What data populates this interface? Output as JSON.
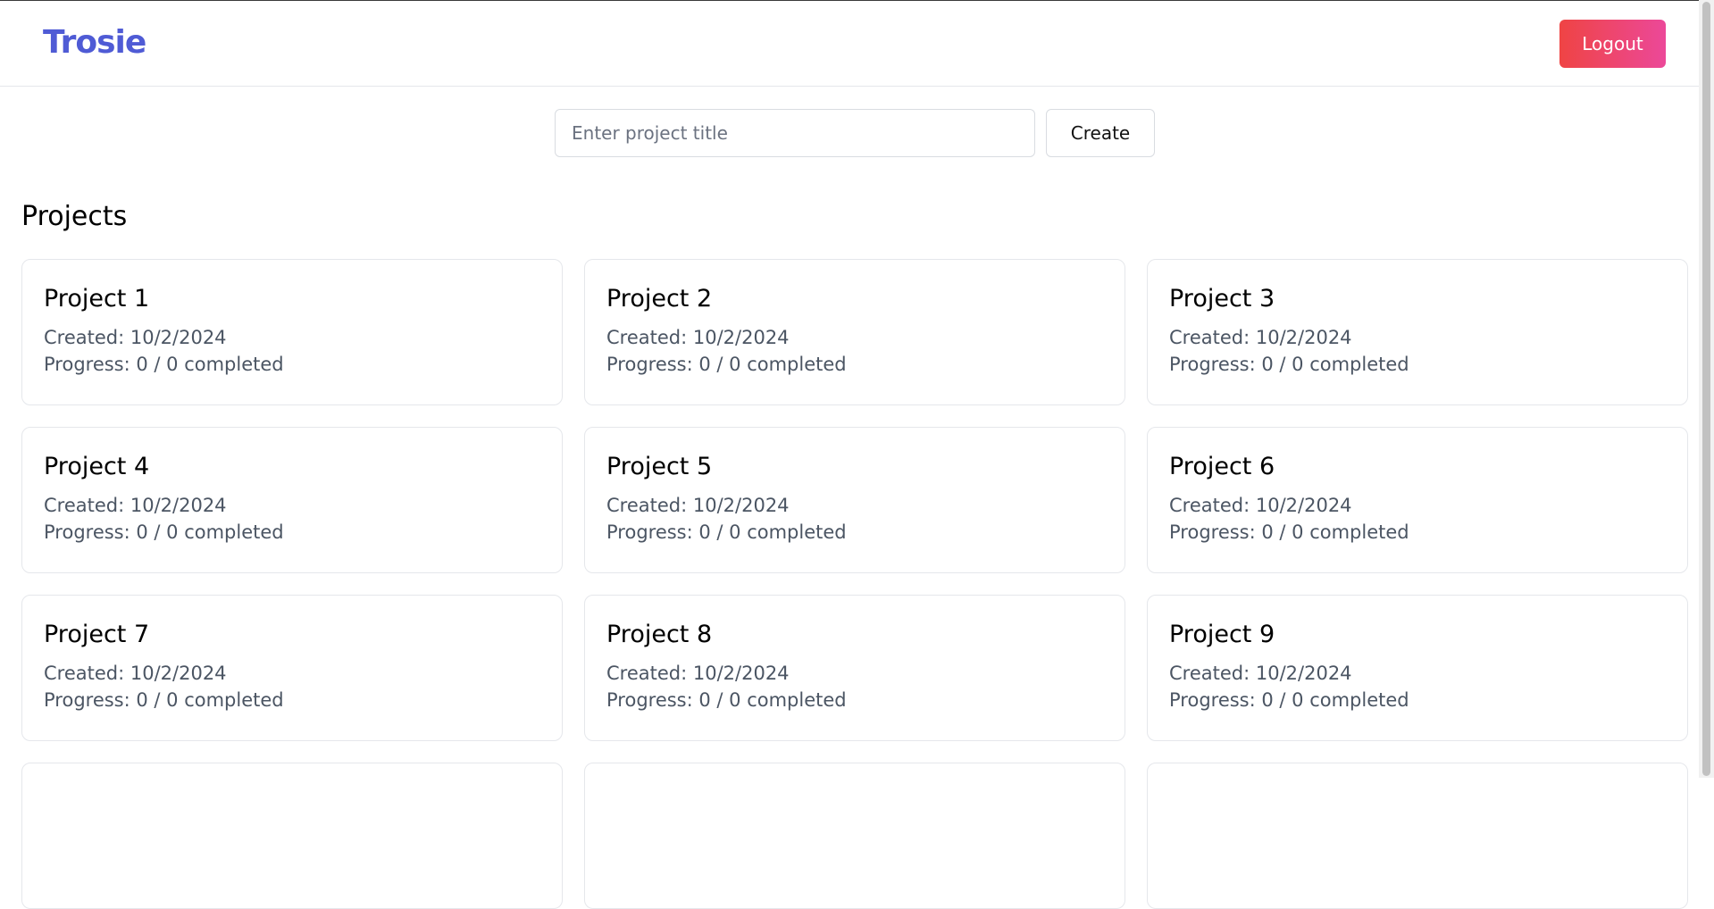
{
  "header": {
    "logo": "Trosie",
    "logout_label": "Logout"
  },
  "create": {
    "placeholder": "Enter project title",
    "value": "",
    "button_label": "Create"
  },
  "projects_section": {
    "title": "Projects",
    "items": [
      {
        "title": "Project 1",
        "created": "Created: 10/2/2024",
        "progress": "Progress: 0 / 0 completed"
      },
      {
        "title": "Project 2",
        "created": "Created: 10/2/2024",
        "progress": "Progress: 0 / 0 completed"
      },
      {
        "title": "Project 3",
        "created": "Created: 10/2/2024",
        "progress": "Progress: 0 / 0 completed"
      },
      {
        "title": "Project 4",
        "created": "Created: 10/2/2024",
        "progress": "Progress: 0 / 0 completed"
      },
      {
        "title": "Project 5",
        "created": "Created: 10/2/2024",
        "progress": "Progress: 0 / 0 completed"
      },
      {
        "title": "Project 6",
        "created": "Created: 10/2/2024",
        "progress": "Progress: 0 / 0 completed"
      },
      {
        "title": "Project 7",
        "created": "Created: 10/2/2024",
        "progress": "Progress: 0 / 0 completed"
      },
      {
        "title": "Project 8",
        "created": "Created: 10/2/2024",
        "progress": "Progress: 0 / 0 completed"
      },
      {
        "title": "Project 9",
        "created": "Created: 10/2/2024",
        "progress": "Progress: 0 / 0 completed"
      },
      {
        "title": "",
        "created": "",
        "progress": ""
      },
      {
        "title": "",
        "created": "",
        "progress": ""
      },
      {
        "title": "",
        "created": "",
        "progress": ""
      }
    ]
  },
  "colors": {
    "brand": "#4f5bd5",
    "logout_gradient_start": "#ef4444",
    "logout_gradient_end": "#ec4899",
    "border": "#e5e7eb",
    "muted_text": "#4b5563"
  }
}
